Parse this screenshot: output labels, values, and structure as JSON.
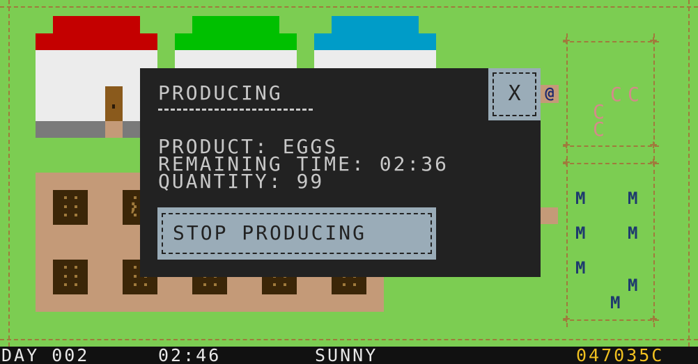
{
  "colors": {
    "grass": "#7ccd52",
    "fence": "#a07a3c",
    "dirt": "#c49a78",
    "dialog_bg": "#222222",
    "button_bg": "#9aacb8",
    "money": "#f0c020",
    "roof_red": "#c40000",
    "roof_green": "#00c000",
    "roof_blue": "#009cc8"
  },
  "dialog": {
    "title": "PRODUCING",
    "product_line": "PRODUCT: EGGS",
    "time_line": "REMAINING TIME: 02:36",
    "quantity_line": "QUANTITY: 99",
    "close_label": "X",
    "stop_label": "STOP PRODUCING"
  },
  "world": {
    "player_glyph": "@",
    "chick_glyph": "C",
    "cow_glyph": "M",
    "crop_glyph": ";"
  },
  "status": {
    "day": "DAY 002",
    "time": "02:46",
    "weather": "SUNNY",
    "money": "047035C"
  }
}
